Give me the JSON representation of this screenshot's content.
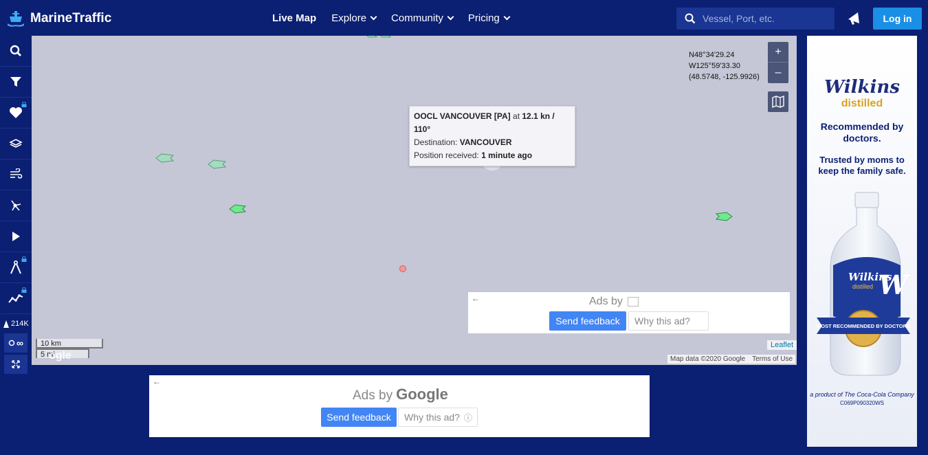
{
  "header": {
    "logo_text": "MarineTraffic",
    "nav": [
      {
        "label": "Live Map",
        "active": true,
        "dropdown": false
      },
      {
        "label": "Explore",
        "active": false,
        "dropdown": true
      },
      {
        "label": "Community",
        "active": false,
        "dropdown": true
      },
      {
        "label": "Pricing",
        "active": false,
        "dropdown": true
      }
    ],
    "search_placeholder": "Vessel, Port, etc.",
    "login_label": "Log in"
  },
  "sidebar": {
    "vessel_count": "214K",
    "infinity_label": "∞"
  },
  "map": {
    "coords": {
      "lat": "N48°34'29.24",
      "lon": "W125°59'33.30",
      "decimal": "(48.5748, -125.9926)"
    },
    "zoom_in": "+",
    "zoom_out": "–",
    "tooltip": {
      "vessel": "OOCL VANCOUVER [PA]",
      "speed_text": "at",
      "speed": "12.1 kn / 110°",
      "destination_label": "Destination:",
      "destination": "VANCOUVER",
      "position_label": "Position received:",
      "position": "1 minute ago"
    },
    "scale_km": "10 km",
    "scale_mi": "5 mi",
    "watermark": "ogle",
    "leaflet": "Leaflet",
    "attribution": "Map data ©2020 Google",
    "terms": "Terms of Use"
  },
  "ads": {
    "back_arrow": "←",
    "ads_by": "Ads by",
    "google": "Google",
    "send_feedback": "Send feedback",
    "why_this_ad": "Why this ad?",
    "info_icon": "ⓘ"
  },
  "right_ad": {
    "brand_line1": "Wilkins",
    "brand_line2": "distilled",
    "headline": "Recommended by doctors.",
    "subline": "Trusted by moms to keep the family safe.",
    "bottle_brand": "Wilkins",
    "bottle_sub": "distilled",
    "badge_text": "MOST RECOMMENDED BY DOCTORS",
    "product_of": "a product of The Coca-Cola Company",
    "code": "C069P090320WS"
  }
}
